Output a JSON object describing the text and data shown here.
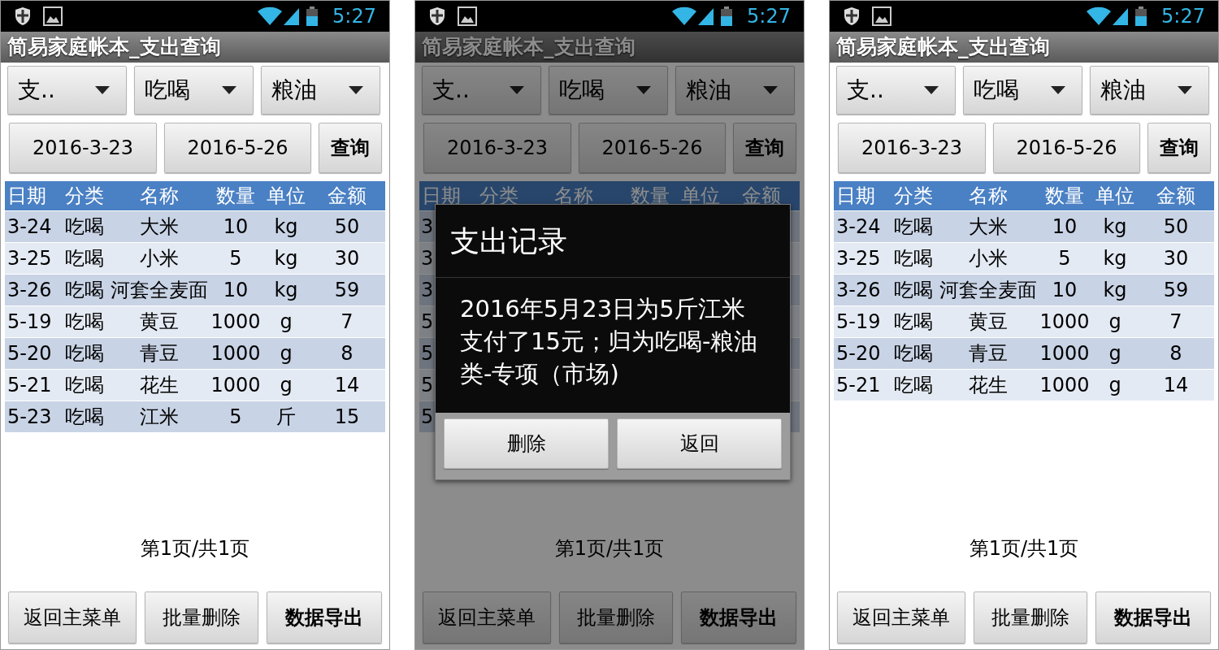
{
  "screens": [
    {
      "status_bar": {
        "time": "5:27"
      },
      "title": "简易家庭帐本_支出查询",
      "dimmed": false,
      "spinners": [
        {
          "value": "支.."
        },
        {
          "value": "吃喝"
        },
        {
          "value": "粮油"
        }
      ],
      "date_from": "2016-3-23",
      "date_to": "2016-5-26",
      "query_button": "查询",
      "table": {
        "columns": [
          "日期",
          "分类",
          "名称",
          "数量",
          "单位",
          "金额"
        ],
        "rows": [
          [
            "3-24",
            "吃喝",
            "大米",
            "10",
            "kg",
            "50"
          ],
          [
            "3-25",
            "吃喝",
            "小米",
            "5",
            "kg",
            "30"
          ],
          [
            "3-26",
            "吃喝",
            "河套全麦面",
            "10",
            "kg",
            "59"
          ],
          [
            "5-19",
            "吃喝",
            "黄豆",
            "1000",
            "g",
            "7"
          ],
          [
            "5-20",
            "吃喝",
            "青豆",
            "1000",
            "g",
            "8"
          ],
          [
            "5-21",
            "吃喝",
            "花生",
            "1000",
            "g",
            "14"
          ],
          [
            "5-23",
            "吃喝",
            "江米",
            "5",
            "斤",
            "15"
          ]
        ]
      },
      "pager": "第1页/共1页",
      "buttons": [
        {
          "label": "返回主菜单",
          "bold": false
        },
        {
          "label": "批量删除",
          "bold": false
        },
        {
          "label": "数据导出",
          "bold": true
        }
      ]
    },
    {
      "status_bar": {
        "time": "5:27"
      },
      "title": "简易家庭帐本_支出查询",
      "dimmed": true,
      "spinners": [
        {
          "value": "支.."
        },
        {
          "value": "吃喝"
        },
        {
          "value": "粮油"
        }
      ],
      "date_from": "2016-3-23",
      "date_to": "2016-5-26",
      "query_button": "查询",
      "table": {
        "columns": [
          "日期",
          "分类",
          "名称",
          "数量",
          "单位",
          "金额"
        ],
        "partial_rows": [
          "3",
          "3",
          "3",
          "5",
          "5",
          "5",
          "5"
        ]
      },
      "pager": "第1页/共1页",
      "buttons": [
        {
          "label": "返回主菜单",
          "bold": false
        },
        {
          "label": "批量删除",
          "bold": false
        },
        {
          "label": "数据导出",
          "bold": true
        }
      ],
      "dialog": {
        "title": "支出记录",
        "message": "2016年5月23日为5斤江米支付了15元；归为吃喝-粮油类-专项（市场)",
        "buttons": [
          "删除",
          "返回"
        ]
      }
    },
    {
      "status_bar": {
        "time": "5:27"
      },
      "title": "简易家庭帐本_支出查询",
      "dimmed": false,
      "spinners": [
        {
          "value": "支.."
        },
        {
          "value": "吃喝"
        },
        {
          "value": "粮油"
        }
      ],
      "date_from": "2016-3-23",
      "date_to": "2016-5-26",
      "query_button": "查询",
      "table": {
        "columns": [
          "日期",
          "分类",
          "名称",
          "数量",
          "单位",
          "金额"
        ],
        "rows": [
          [
            "3-24",
            "吃喝",
            "大米",
            "10",
            "kg",
            "50"
          ],
          [
            "3-25",
            "吃喝",
            "小米",
            "5",
            "kg",
            "30"
          ],
          [
            "3-26",
            "吃喝",
            "河套全麦面",
            "10",
            "kg",
            "59"
          ],
          [
            "5-19",
            "吃喝",
            "黄豆",
            "1000",
            "g",
            "7"
          ],
          [
            "5-20",
            "吃喝",
            "青豆",
            "1000",
            "g",
            "8"
          ],
          [
            "5-21",
            "吃喝",
            "花生",
            "1000",
            "g",
            "14"
          ]
        ]
      },
      "pager": "第1页/共1页",
      "buttons": [
        {
          "label": "返回主菜单",
          "bold": false
        },
        {
          "label": "批量删除",
          "bold": false
        },
        {
          "label": "数据导出",
          "bold": true
        }
      ]
    }
  ]
}
